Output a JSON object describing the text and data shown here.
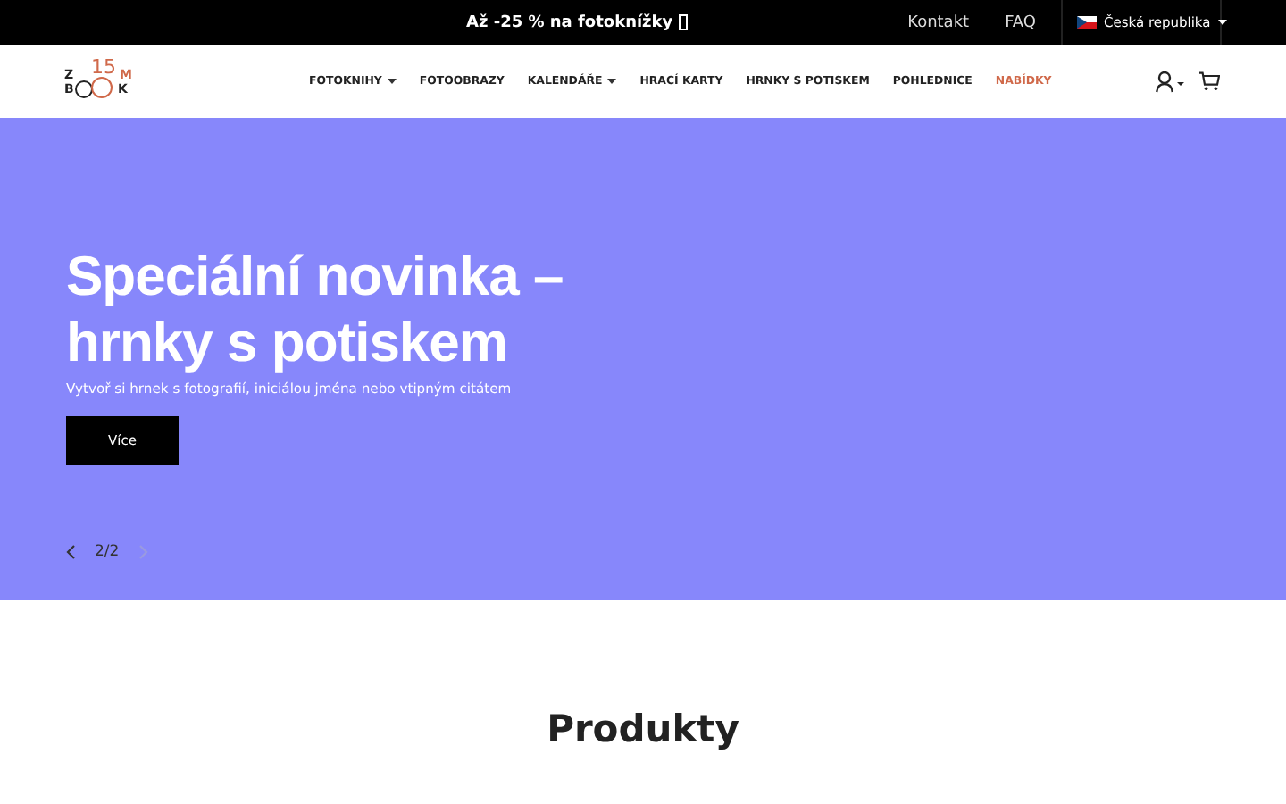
{
  "promo_bar": {
    "text": "Až -25 % na fotoknížky",
    "links": [
      "Kontakt",
      "FAQ"
    ],
    "country": "Česká republika"
  },
  "logo": {
    "letter_top": "Z",
    "letter_bottom": "B",
    "number": "15",
    "letter_right_top": "M",
    "letter_right_bottom": "K"
  },
  "nav": [
    {
      "label": "FOTOKNIHY",
      "dropdown": true,
      "accent": false
    },
    {
      "label": "FOTOOBRAZY",
      "dropdown": false,
      "accent": false
    },
    {
      "label": "KALENDÁŘE",
      "dropdown": true,
      "accent": false
    },
    {
      "label": "HRACÍ KARTY",
      "dropdown": false,
      "accent": false
    },
    {
      "label": "HRNKY S POTISKEM",
      "dropdown": false,
      "accent": false
    },
    {
      "label": "POHLEDNICE",
      "dropdown": false,
      "accent": false
    },
    {
      "label": "NABÍDKY",
      "dropdown": false,
      "accent": true
    }
  ],
  "hero": {
    "title_lines": [
      "Speciální novinka –",
      "hrnky s potiskem"
    ],
    "subtitle": "Vytvoř si hrnek s fotografií, iniciálou jména nebo vtipným citátem",
    "button": "Více",
    "counter": "2/2",
    "prev_disabled": false,
    "next_disabled": true
  },
  "section": {
    "title": "Produkty"
  }
}
